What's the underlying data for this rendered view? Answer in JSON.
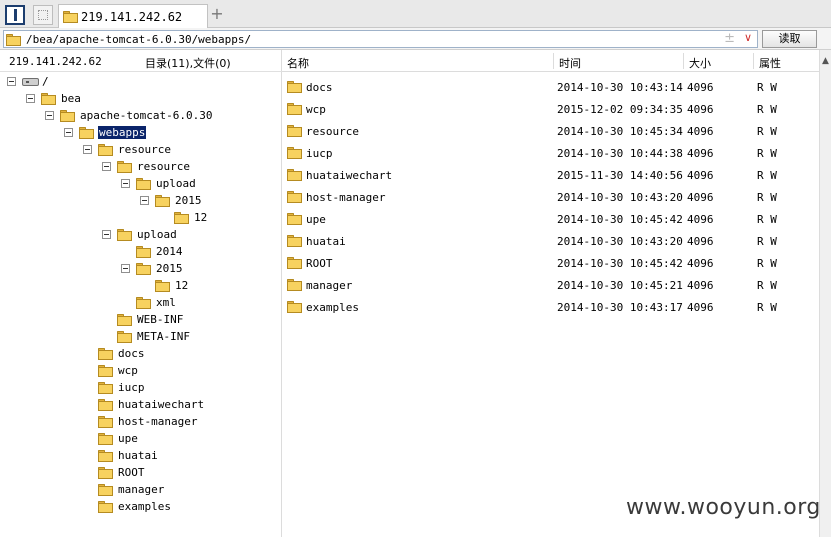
{
  "tab": {
    "title": "219.141.242.62",
    "add_label": "+"
  },
  "address": {
    "path": "/bea/apache-tomcat-6.0.30/webapps/",
    "pin_glyph": "±",
    "drop_glyph": "∨",
    "read_label": "读取"
  },
  "left": {
    "ip": "219.141.242.62",
    "summary": "目录(11),文件(0)",
    "tree": [
      {
        "label": "/",
        "icon": "drive-icon",
        "expander": true
      },
      {
        "label": "bea",
        "expander": true
      },
      {
        "label": "apache-tomcat-6.0.30",
        "expander": true
      },
      {
        "label": "webapps",
        "expander": true,
        "selected": true
      },
      {
        "label": "resource",
        "expander": true
      },
      {
        "label": "resource",
        "expander": true
      },
      {
        "label": "upload",
        "expander": true
      },
      {
        "label": "2015",
        "expander": true
      },
      {
        "label": "12"
      },
      {
        "label": "upload",
        "expander": true
      },
      {
        "label": "2014"
      },
      {
        "label": "2015",
        "expander": true
      },
      {
        "label": "12"
      },
      {
        "label": "xml"
      },
      {
        "label": "WEB-INF"
      },
      {
        "label": "META-INF"
      },
      {
        "label": "docs"
      },
      {
        "label": "wcp"
      },
      {
        "label": "iucp"
      },
      {
        "label": "huataiwechart"
      },
      {
        "label": "host-manager"
      },
      {
        "label": "upe"
      },
      {
        "label": "huatai"
      },
      {
        "label": "ROOT"
      },
      {
        "label": "manager"
      },
      {
        "label": "examples"
      }
    ]
  },
  "files": {
    "columns": {
      "name": "名称",
      "time": "时间",
      "size": "大小",
      "attr": "属性"
    },
    "rows": [
      {
        "name": "docs",
        "time": "2014-10-30 10:43:14",
        "size": "4096",
        "attr": "R W"
      },
      {
        "name": "wcp",
        "time": "2015-12-02 09:34:35",
        "size": "4096",
        "attr": "R W"
      },
      {
        "name": "resource",
        "time": "2014-10-30 10:45:34",
        "size": "4096",
        "attr": "R W"
      },
      {
        "name": "iucp",
        "time": "2014-10-30 10:44:38",
        "size": "4096",
        "attr": "R W"
      },
      {
        "name": "huataiwechart",
        "time": "2015-11-30 14:40:56",
        "size": "4096",
        "attr": "R W"
      },
      {
        "name": "host-manager",
        "time": "2014-10-30 10:43:20",
        "size": "4096",
        "attr": "R W"
      },
      {
        "name": "upe",
        "time": "2014-10-30 10:45:42",
        "size": "4096",
        "attr": "R W"
      },
      {
        "name": "huatai",
        "time": "2014-10-30 10:43:20",
        "size": "4096",
        "attr": "R W"
      },
      {
        "name": "ROOT",
        "time": "2014-10-30 10:45:42",
        "size": "4096",
        "attr": "R W"
      },
      {
        "name": "manager",
        "time": "2014-10-30 10:45:21",
        "size": "4096",
        "attr": "R W"
      },
      {
        "name": "examples",
        "time": "2014-10-30 10:43:17",
        "size": "4096",
        "attr": "R W"
      }
    ]
  },
  "watermark": "www.wooyun.org",
  "colors": {
    "selection": "#0a246a",
    "folder": "#f7d25f",
    "accent": "#1c3d6e"
  }
}
